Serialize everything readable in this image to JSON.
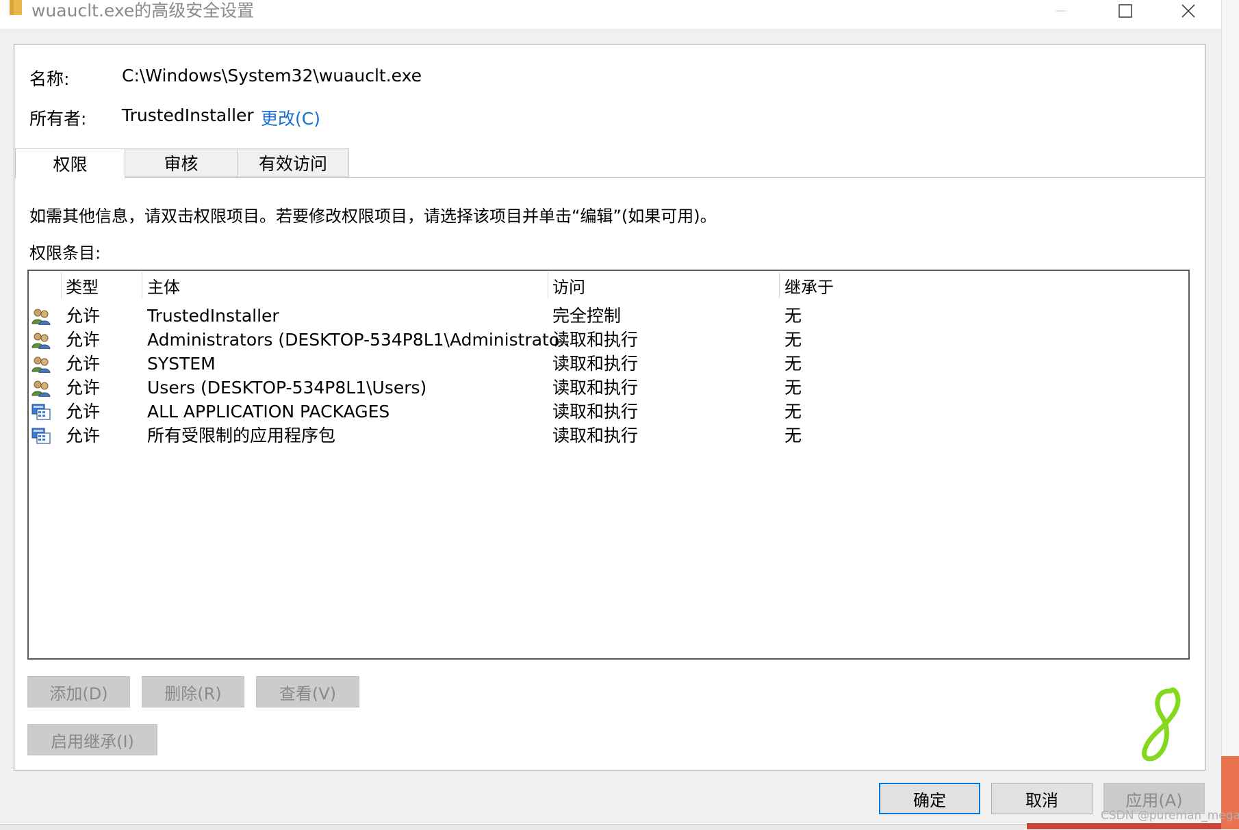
{
  "window": {
    "title": "wuauclt.exe的高级安全设置"
  },
  "name": {
    "label": "名称:",
    "value": "C:\\Windows\\System32\\wuauclt.exe"
  },
  "owner": {
    "label": "所有者:",
    "value": "TrustedInstaller",
    "change_label": "更改(C)"
  },
  "tabs": [
    {
      "label": "权限",
      "selected": true
    },
    {
      "label": "审核",
      "selected": false
    },
    {
      "label": "有效访问",
      "selected": false
    }
  ],
  "info_text": "如需其他信息，请双击权限项目。若要修改权限项目，请选择该项目并单击“编辑”(如果可用)。",
  "entries_label": "权限条目:",
  "columns": [
    "类型",
    "主体",
    "访问",
    "继承于"
  ],
  "entries": [
    {
      "icon": "user-group-icon",
      "type": "允许",
      "principal": "TrustedInstaller",
      "access": "完全控制",
      "inherited_from": "无"
    },
    {
      "icon": "user-group-icon",
      "type": "允许",
      "principal": "Administrators (DESKTOP-534P8L1\\Administrato...",
      "access": "读取和执行",
      "inherited_from": "无"
    },
    {
      "icon": "user-group-icon",
      "type": "允许",
      "principal": "SYSTEM",
      "access": "读取和执行",
      "inherited_from": "无"
    },
    {
      "icon": "user-group-icon",
      "type": "允许",
      "principal": "Users (DESKTOP-534P8L1\\Users)",
      "access": "读取和执行",
      "inherited_from": "无"
    },
    {
      "icon": "app-package-icon",
      "type": "允许",
      "principal": "ALL APPLICATION PACKAGES",
      "access": "读取和执行",
      "inherited_from": "无"
    },
    {
      "icon": "app-package-icon",
      "type": "允许",
      "principal": "所有受限制的应用程序包",
      "access": "读取和执行",
      "inherited_from": "无"
    }
  ],
  "buttons": {
    "add": "添加(D)",
    "remove": "删除(R)",
    "view": "查看(V)",
    "enable_inheritance": "启用继承(I)",
    "ok": "确定",
    "cancel": "取消",
    "apply": "应用(A)"
  },
  "watermark": "CSDN @pureman_mega",
  "colors": {
    "link": "#1a6fd6",
    "default_button_border": "#0078d7",
    "disabled_button_bg": "#cccccc"
  }
}
